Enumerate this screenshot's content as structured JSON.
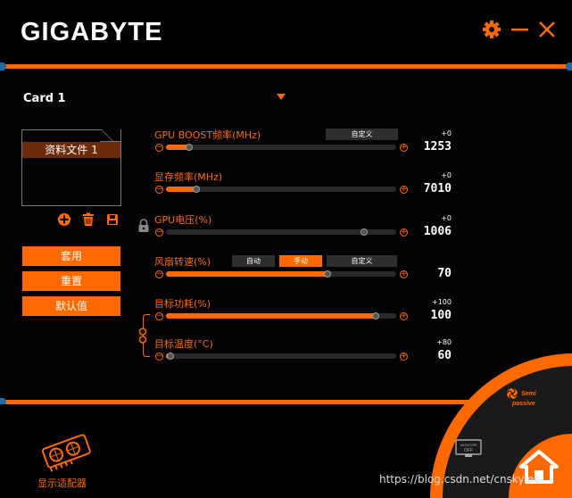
{
  "app": {
    "brand": "GIGABYTE"
  },
  "card": {
    "label": "Card 1"
  },
  "profile": {
    "items": [
      "资料文件 1"
    ]
  },
  "actions": {
    "apply": "套用",
    "reset": "重置",
    "default": "默认值"
  },
  "sliders": [
    {
      "title": "GPU BOOST频率(MHz)",
      "delta": "+0",
      "value": "1253",
      "fraction": 0.1,
      "fill": true,
      "mode_buttons": [
        "自定义"
      ]
    },
    {
      "title": "显存频率(MHz)",
      "delta": "+0",
      "value": "7010",
      "fraction": 0.13,
      "fill": true
    },
    {
      "title": "GPU电压(%)",
      "delta": "+0",
      "value": "1006",
      "fraction": 0.86,
      "fill": false
    },
    {
      "title": "风扇转速(%)",
      "delta": "",
      "value": "70",
      "fraction": 0.7,
      "fill": true,
      "mode_buttons": [
        "自动",
        "手动",
        "自定义"
      ],
      "active_mode": "手动"
    },
    {
      "title": "目标功耗(%)",
      "delta": "+100",
      "value": "100",
      "fraction": 0.91,
      "fill": true
    },
    {
      "title": "目标温度(°C)",
      "delta": "+80",
      "value": "60",
      "fraction": 0.02,
      "fill": true
    }
  ],
  "corner": {
    "fan_mode": "Semi passive",
    "monitor": "MONITOR OFF"
  },
  "bottom": {
    "adapter_label": "显示适配器"
  },
  "watermark": "https://blog.csdn.net/cnskylee",
  "colors": {
    "accent": "#ff6a00",
    "accent_dark": "#6b2a08",
    "track": "#2a2a2a",
    "edge_blue": "#1f6aa5"
  },
  "icons": [
    "settings-gear-icon",
    "minimize-icon",
    "close-icon",
    "add-profile-icon",
    "delete-profile-icon",
    "save-profile-icon",
    "lock-icon",
    "link-icon",
    "graphics-card-icon",
    "semi-passive-fan-icon",
    "monitor-off-icon",
    "home-icon"
  ]
}
